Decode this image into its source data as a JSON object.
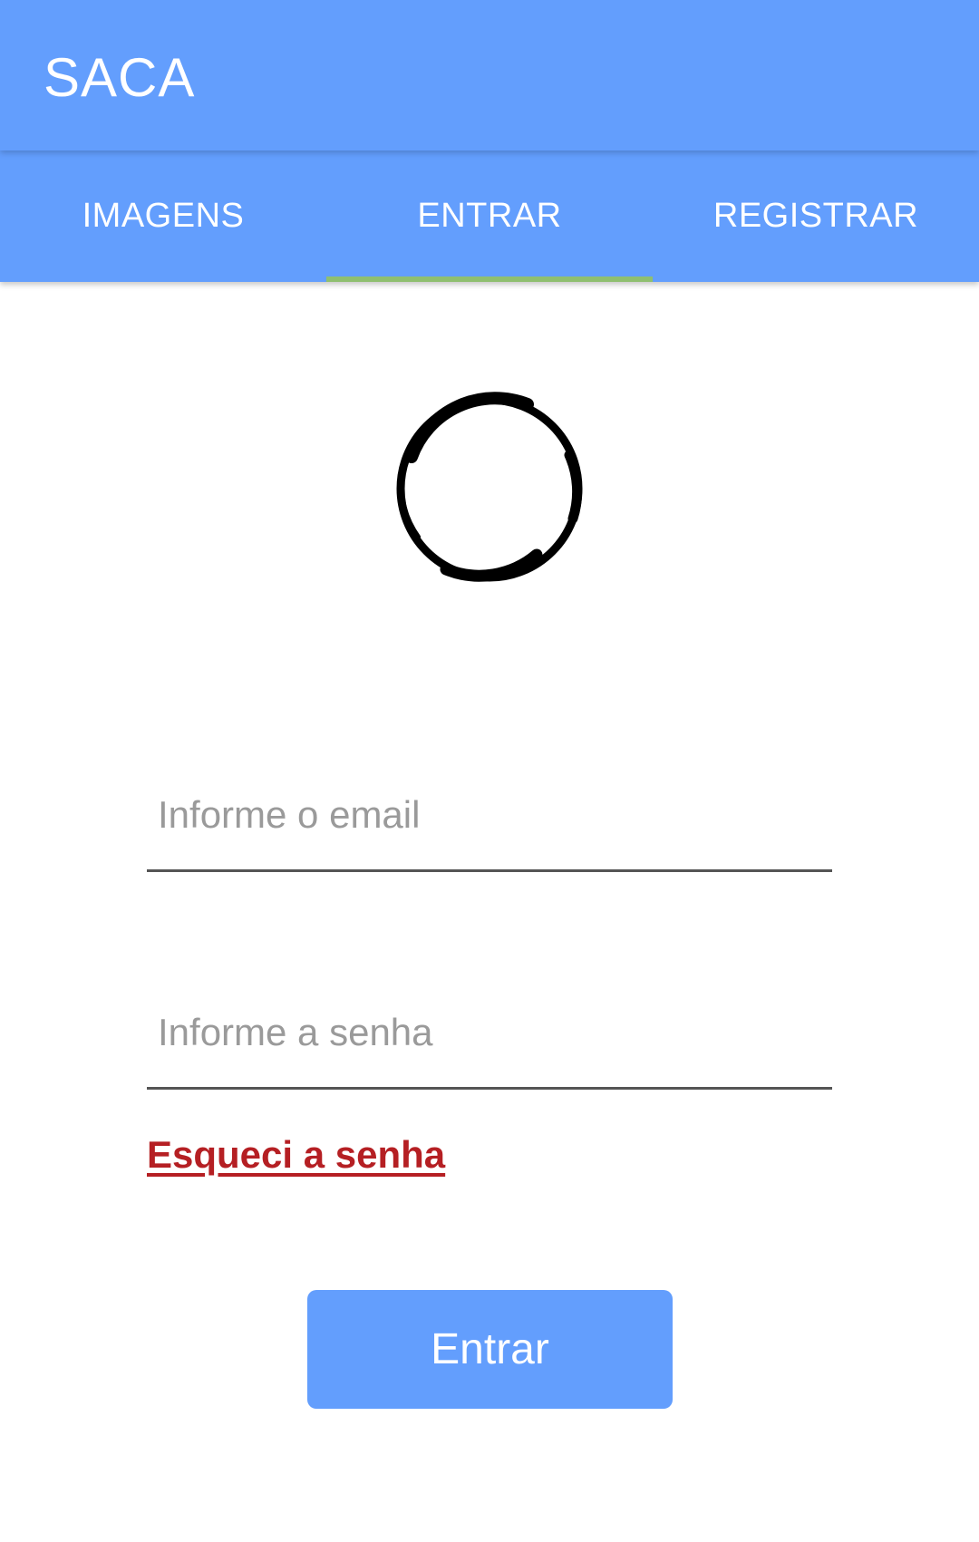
{
  "app": {
    "title": "SACA"
  },
  "tabs": [
    {
      "label": "IMAGENS",
      "active": false
    },
    {
      "label": "ENTRAR",
      "active": true
    },
    {
      "label": "REGISTRAR",
      "active": false
    }
  ],
  "logo": {
    "icon": "enso-circle-icon"
  },
  "form": {
    "email": {
      "value": "",
      "placeholder": "Informe o email"
    },
    "password": {
      "value": "",
      "placeholder": "Informe a senha"
    },
    "forgot_label": "Esqueci a senha",
    "submit_label": "Entrar"
  },
  "colors": {
    "primary": "#639efd",
    "tab_indicator": "#8fbf70",
    "link": "#b51f23",
    "underline": "#555555"
  }
}
